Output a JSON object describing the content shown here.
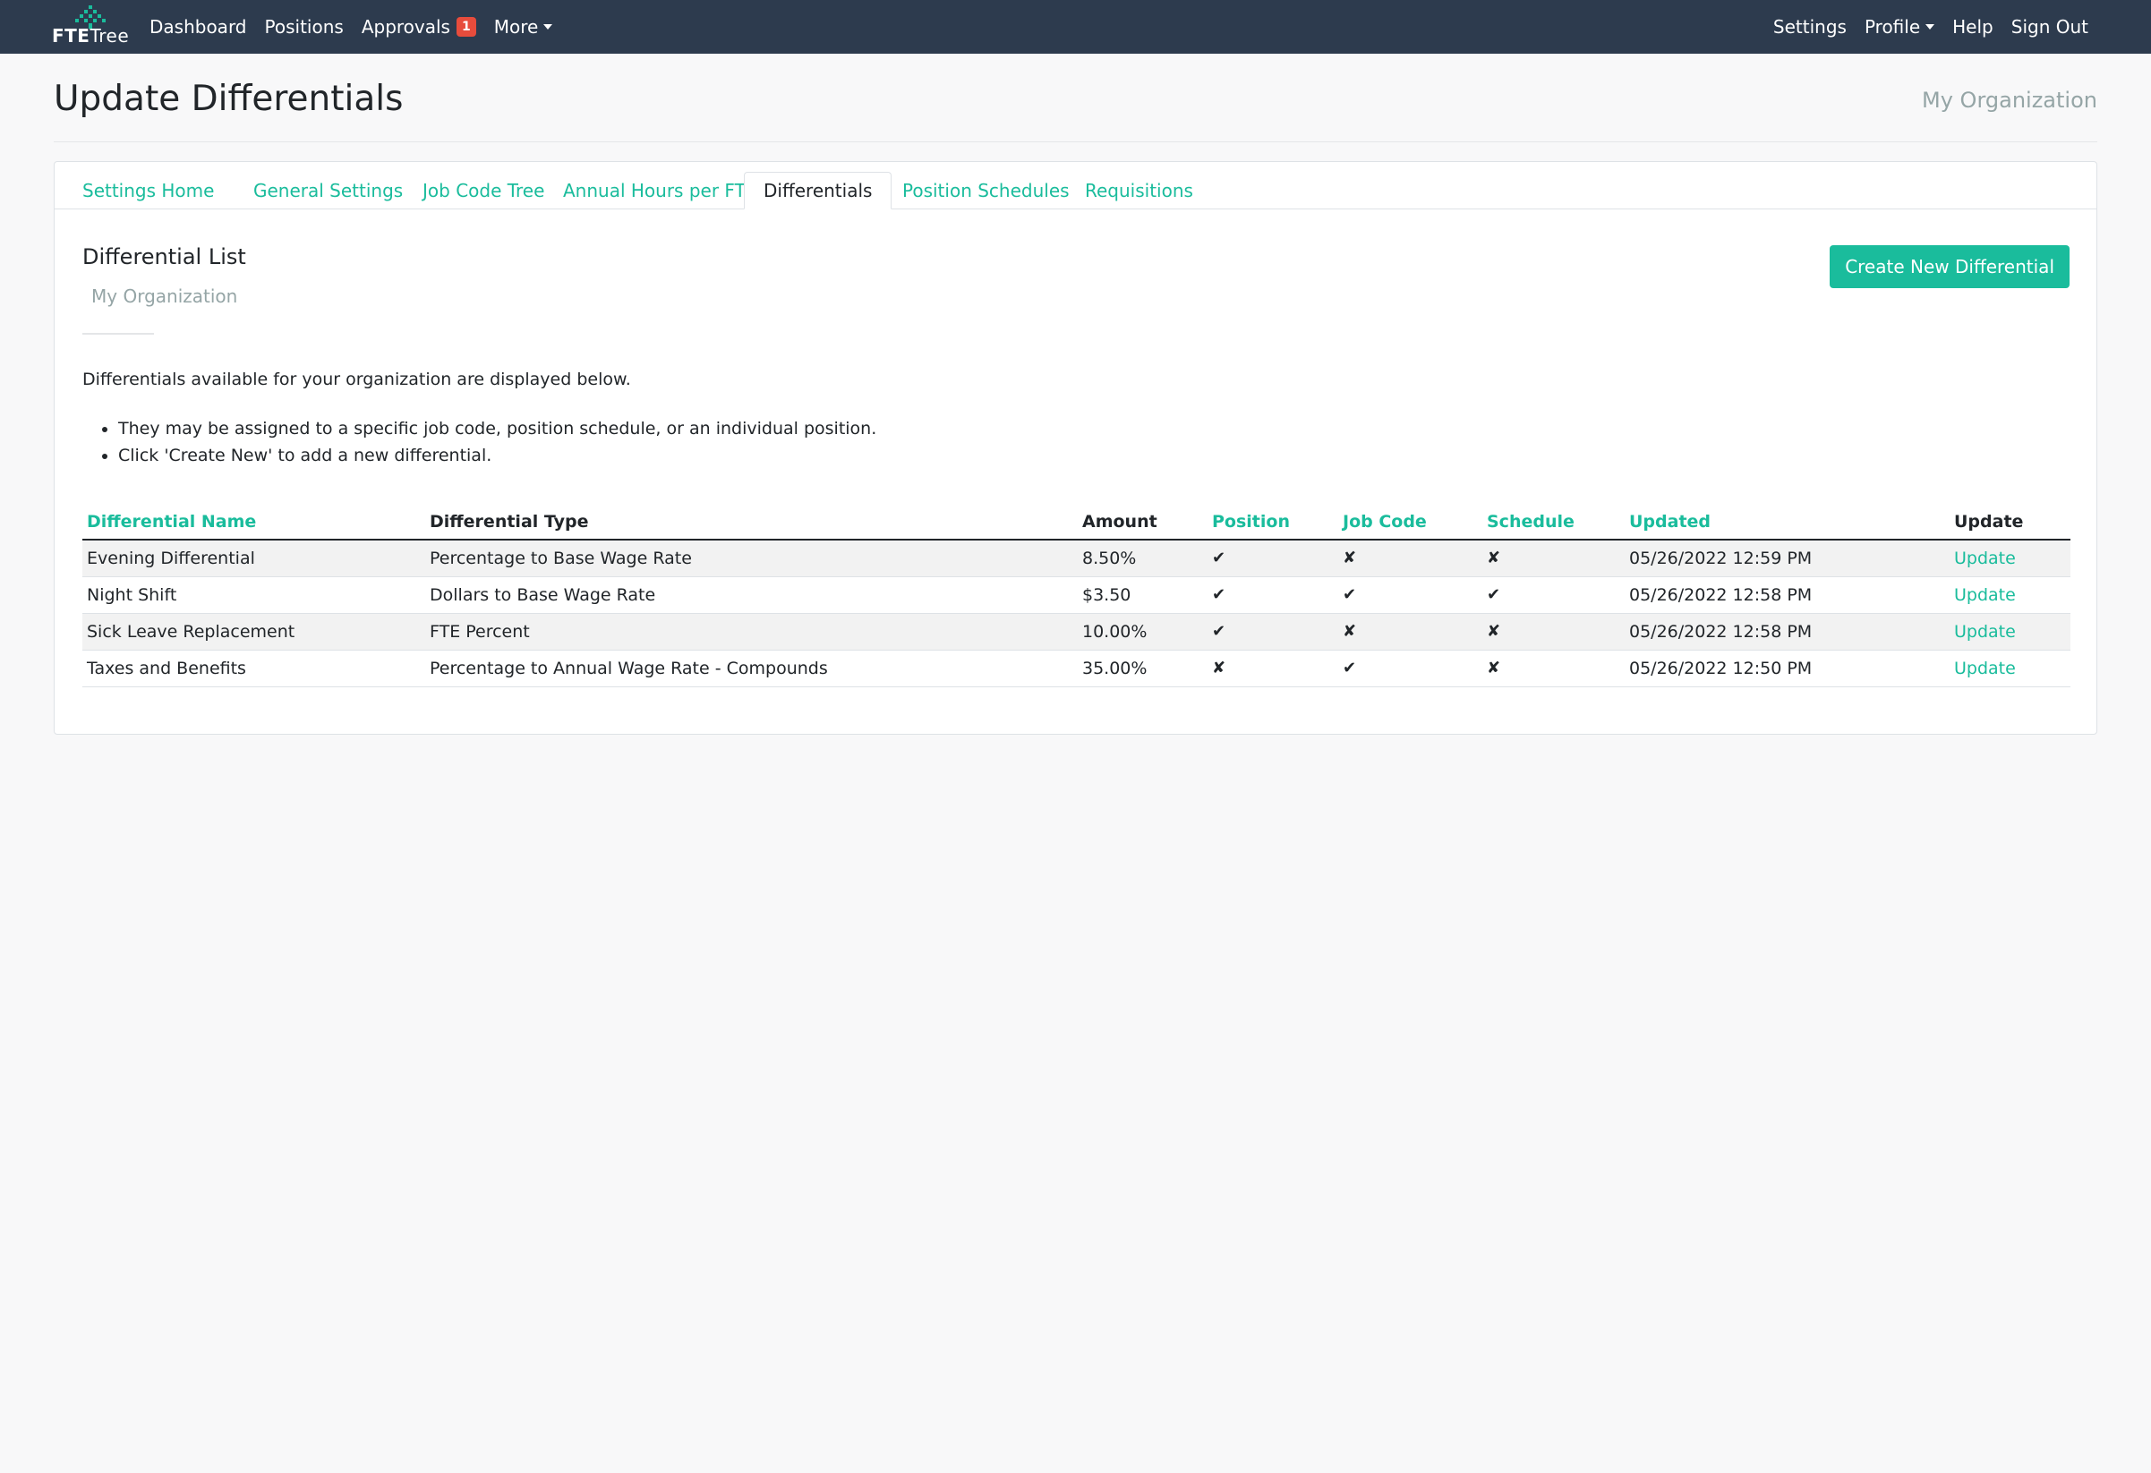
{
  "nav": {
    "brand": {
      "bold": "FTE",
      "rest": "Tree"
    },
    "left": [
      {
        "label": "Dashboard"
      },
      {
        "label": "Positions"
      },
      {
        "label": "Approvals",
        "badge": "1"
      },
      {
        "label": "More"
      }
    ],
    "right": [
      {
        "label": "Settings"
      },
      {
        "label": "Profile"
      },
      {
        "label": "Help"
      },
      {
        "label": "Sign Out"
      }
    ]
  },
  "header": {
    "title": "Update Differentials",
    "org": "My Organization"
  },
  "tabs": [
    {
      "label": "Settings Home"
    },
    {
      "label": "General Settings"
    },
    {
      "label": "Job Code Tree"
    },
    {
      "label": "Annual Hours per FTE"
    },
    {
      "label": "Differentials",
      "active": true
    },
    {
      "label": "Position Schedules"
    },
    {
      "label": "Requisitions"
    }
  ],
  "section": {
    "title": "Differential List",
    "subtitle": "My Organization",
    "create_label": "Create New Differential",
    "intro": "Differentials available for your organization are displayed below.",
    "bullets": [
      "They may be assigned to a specific job code, position schedule, or an individual position.",
      "Click 'Create New' to add a new differential."
    ]
  },
  "table": {
    "headers": {
      "name": "Differential Name",
      "type": "Differential Type",
      "amount": "Amount",
      "position": "Position",
      "job_code": "Job Code",
      "schedule": "Schedule",
      "updated": "Updated",
      "update": "Update"
    },
    "rows": [
      {
        "name": "Evening Differential",
        "type": "Percentage to Base Wage Rate",
        "amount": "8.50%",
        "position": "✔",
        "job_code": "✘",
        "schedule": "✘",
        "updated": "05/26/2022 12:59 PM",
        "update": "Update"
      },
      {
        "name": "Night Shift",
        "type": "Dollars to Base Wage Rate",
        "amount": "$3.50",
        "position": "✔",
        "job_code": "✔",
        "schedule": "✔",
        "updated": "05/26/2022 12:58 PM",
        "update": "Update"
      },
      {
        "name": "Sick Leave Replacement",
        "type": "FTE Percent",
        "amount": "10.00%",
        "position": "✔",
        "job_code": "✘",
        "schedule": "✘",
        "updated": "05/26/2022 12:58 PM",
        "update": "Update"
      },
      {
        "name": "Taxes and Benefits",
        "type": "Percentage to Annual Wage Rate - Compounds",
        "amount": "35.00%",
        "position": "✘",
        "job_code": "✔",
        "schedule": "✘",
        "updated": "05/26/2022 12:50 PM",
        "update": "Update"
      }
    ]
  },
  "colors": {
    "navbar": "#2d3b4e",
    "accent": "#1abc9c",
    "badge": "#e74c3c",
    "muted": "#95a5a6"
  }
}
